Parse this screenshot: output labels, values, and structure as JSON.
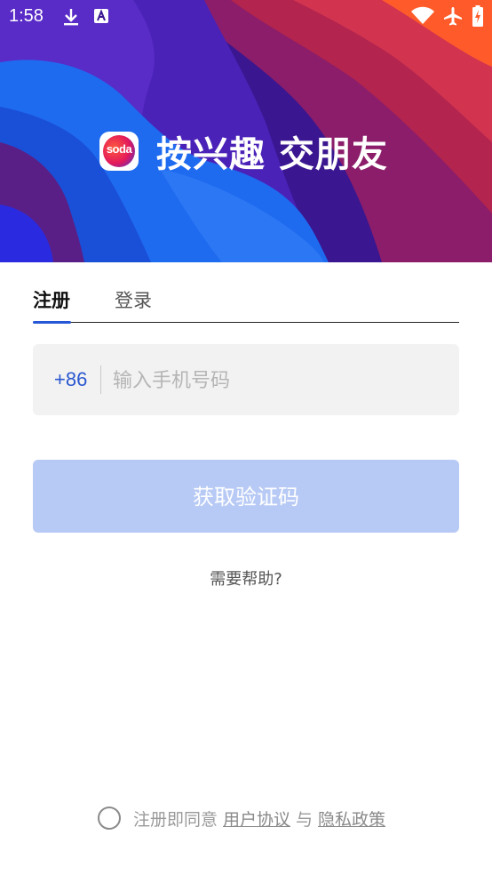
{
  "status_bar": {
    "time": "1:58",
    "icons": [
      "download-icon",
      "font-a-icon",
      "wifi-icon",
      "airplane-icon",
      "battery-charging-icon"
    ]
  },
  "hero": {
    "logo_text": "soda",
    "slogan": "按兴趣 交朋友",
    "colors": [
      "#1e6bf0",
      "#5b2cc9",
      "#8a1c6e",
      "#d8384e",
      "#ff5a2a"
    ]
  },
  "tabs": {
    "register": "注册",
    "login": "登录"
  },
  "phone": {
    "country_code": "+86",
    "value": "",
    "placeholder": "输入手机号码"
  },
  "actions": {
    "get_code": "获取验证码",
    "help": "需要帮助?"
  },
  "agreement": {
    "prefix": "注册即同意",
    "user_agreement": "用户协议",
    "and": "与",
    "privacy_policy": "隐私政策"
  },
  "accent_color": "#2557d6"
}
